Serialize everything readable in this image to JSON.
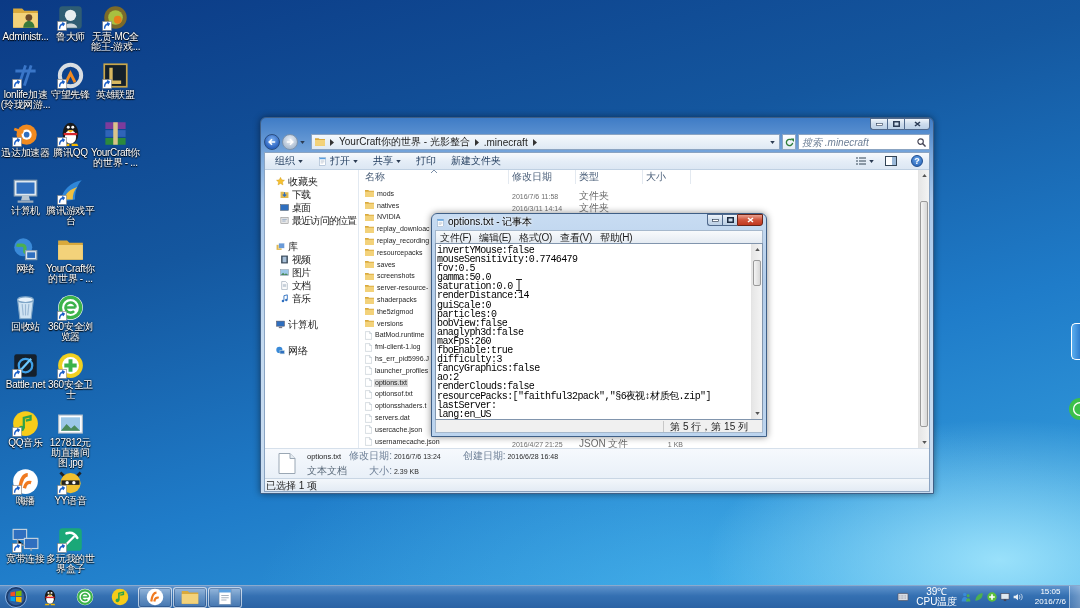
{
  "desktop_icon_rows": [
    [
      {
        "label": "Administr...",
        "shortcut": false
      },
      {
        "label": "鲁大师",
        "shortcut": true
      },
      {
        "label": "无责-MC全能王-游戏...",
        "shortcut": true
      }
    ],
    [
      {
        "label": "lonlife加速(玲珑网游...",
        "shortcut": true
      },
      {
        "label": "守望先锋",
        "shortcut": true
      },
      {
        "label": "英雄联盟",
        "shortcut": true
      }
    ],
    [
      {
        "label": "迅达加速器",
        "shortcut": true
      },
      {
        "label": "腾讯QQ",
        "shortcut": true
      },
      {
        "label": "YourCraft你的世界 - ...",
        "shortcut": false
      }
    ],
    [
      {
        "label": "计算机",
        "shortcut": false
      },
      {
        "label": "腾讯游戏平台",
        "shortcut": true
      }
    ],
    [
      {
        "label": "网络",
        "shortcut": false
      },
      {
        "label": "YourCraft你的世界 - ...",
        "shortcut": false
      }
    ],
    [
      {
        "label": "回收站",
        "shortcut": false
      },
      {
        "label": "360安全浏览器",
        "shortcut": true
      }
    ],
    [
      {
        "label": "Battle.net",
        "shortcut": true
      },
      {
        "label": "360安全卫士",
        "shortcut": true
      }
    ],
    [
      {
        "label": "QQ音乐",
        "shortcut": true
      },
      {
        "label": "127812元助直播间图.jpg",
        "shortcut": false
      }
    ],
    [
      {
        "label": "嗨播",
        "shortcut": true
      },
      {
        "label": "YY语音",
        "shortcut": true
      }
    ],
    [
      {
        "label": "宽带连接",
        "shortcut": true
      },
      {
        "label": "多玩我的世界盒子",
        "shortcut": true
      }
    ]
  ],
  "explorer": {
    "active": false,
    "breadcrumb": [
      "YourCraft你的世界 - 光影整合",
      ".minecraft"
    ],
    "search": {
      "placeholder": "搜索 .minecraft"
    },
    "toolbar": [
      {
        "label": "组织",
        "dropdown": true
      },
      {
        "label": "打开",
        "dropdown": true
      },
      {
        "label": "共享",
        "dropdown": true
      },
      {
        "label": "打印",
        "dropdown": false
      },
      {
        "label": "新建文件夹",
        "dropdown": false
      }
    ],
    "help_button": "?",
    "sidebar": [
      {
        "label": "收藏夹",
        "children": [
          {
            "label": "下载"
          },
          {
            "label": "桌面"
          },
          {
            "label": "最近访问的位置"
          }
        ]
      },
      {
        "label": "库",
        "children": [
          {
            "label": "视频"
          },
          {
            "label": "图片"
          },
          {
            "label": "文档"
          },
          {
            "label": "音乐"
          }
        ]
      },
      {
        "label": "计算机"
      },
      {
        "label": "网络"
      }
    ],
    "columns": [
      {
        "label": "名称",
        "sorted": true
      },
      {
        "label": "修改日期",
        "sorted": false
      },
      {
        "label": "类型",
        "sorted": false
      },
      {
        "label": "大小",
        "sorted": false
      }
    ],
    "rows": [
      {
        "name": "mods",
        "kind": "folder",
        "modified": "2016/7/6 11:58",
        "type": "文件夹",
        "selected": false
      },
      {
        "name": "natives",
        "kind": "folder",
        "modified": "2016/3/11 14:14",
        "type": "文件夹",
        "selected": false
      },
      {
        "name": "NVIDIA",
        "kind": "folder",
        "selected": false
      },
      {
        "name": "replay_downloac",
        "kind": "folder",
        "selected": false
      },
      {
        "name": "replay_recording",
        "kind": "folder",
        "selected": false
      },
      {
        "name": "resourcepacks",
        "kind": "folder",
        "selected": false
      },
      {
        "name": "saves",
        "kind": "folder",
        "selected": false
      },
      {
        "name": "screenshots",
        "kind": "folder",
        "selected": false
      },
      {
        "name": "server-resource-",
        "kind": "folder",
        "selected": false
      },
      {
        "name": "shaderpacks",
        "kind": "folder",
        "selected": false
      },
      {
        "name": "the5zigmod",
        "kind": "folder",
        "selected": false
      },
      {
        "name": "versions",
        "kind": "folder",
        "selected": false
      },
      {
        "name": "BatMod.runtime",
        "kind": "file",
        "selected": false
      },
      {
        "name": "fml-client-1.log",
        "kind": "file",
        "selected": false
      },
      {
        "name": "hs_err_pid5996.J",
        "kind": "file",
        "selected": false
      },
      {
        "name": "launcher_profiles",
        "kind": "file",
        "selected": false
      },
      {
        "name": "options.txt",
        "kind": "file",
        "selected": true
      },
      {
        "name": "optionsof.txt",
        "kind": "file",
        "selected": false
      },
      {
        "name": "optionsshaders.t",
        "kind": "file",
        "selected": false
      },
      {
        "name": "servers.dat",
        "kind": "file",
        "selected": false
      },
      {
        "name": "usercache.json",
        "kind": "file",
        "selected": false
      },
      {
        "name": "usernamecache.json",
        "kind": "file",
        "modified": "2016/4/27 21:25",
        "type": "JSON 文件",
        "size": "1 KB",
        "selected": false
      }
    ],
    "details": {
      "name": "options.txt",
      "type": "文本文档",
      "properties": [
        {
          "label": "修改日期:",
          "value": "2016/7/6 13:24"
        },
        {
          "label": "大小:",
          "value": "2.39 KB"
        },
        {
          "label": "创建日期:",
          "value": "2016/6/28 16:48"
        }
      ]
    },
    "status": "已选择 1 项"
  },
  "notepad": {
    "active": true,
    "title": "options.txt - 记事本",
    "menu": [
      "文件(F)",
      "编辑(E)",
      "格式(O)",
      "查看(V)",
      "帮助(H)"
    ],
    "lines": [
      "invertYMouse:false",
      "mouseSensitivity:0.7746479",
      "fov:0.5",
      "gamma:50.0",
      "saturation:0.0",
      "renderDistance:14",
      "guiScale:0",
      "particles:0",
      "bobView:false",
      "anaglyph3d:false",
      "maxFps:260",
      "fboEnable:true",
      "difficulty:3",
      "fancyGraphics:false",
      "ao:2",
      "renderClouds:false",
      "resourcePacks:[\"faithful32pack\",\"§6夜视↕材质包.zip\"]",
      "lastServer:",
      "lang:en_US"
    ],
    "status": "第 5 行，第 15 列"
  },
  "taskbar": {
    "buttons": [
      {
        "running": false
      },
      {
        "running": false
      },
      {
        "running": false
      },
      {
        "running": true
      },
      {
        "running": true
      },
      {
        "running": true
      }
    ],
    "tray": {
      "temperature": "39℃",
      "sensor": "CPU温度",
      "time": "15:05",
      "date": "2016/7/6"
    }
  }
}
